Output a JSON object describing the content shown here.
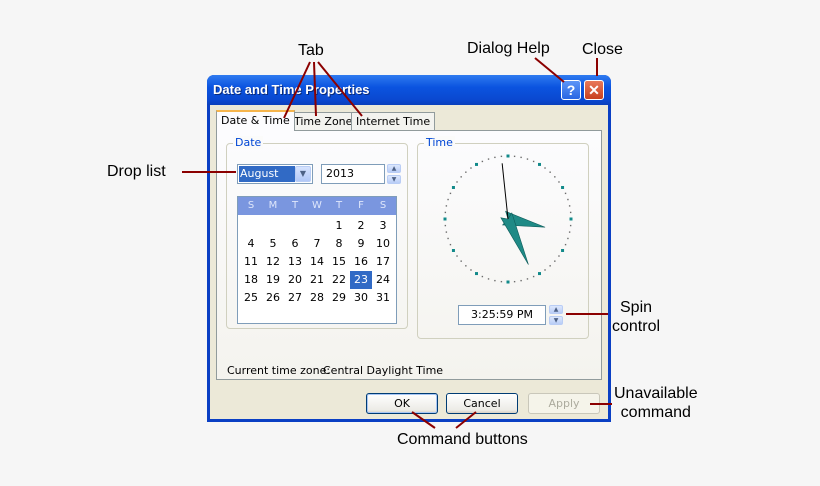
{
  "callouts": {
    "tab": "Tab",
    "dialog_help": "Dialog Help",
    "close": "Close",
    "drop_list": "Drop list",
    "spin_control": [
      "Spin",
      "control"
    ],
    "unavailable_command": [
      "Unavailable",
      "command"
    ],
    "command_buttons": "Command buttons"
  },
  "window": {
    "title": "Date and Time Properties",
    "help_label": "?",
    "close_label": "✕"
  },
  "tabs": [
    {
      "label": "Date & Time",
      "active": true
    },
    {
      "label": "Time Zone",
      "active": false
    },
    {
      "label": "Internet Time",
      "active": false
    }
  ],
  "date_group": {
    "label": "Date",
    "month": "August",
    "year": "2013",
    "weekdays": [
      "S",
      "M",
      "T",
      "W",
      "T",
      "F",
      "S"
    ],
    "weeks": [
      [
        "",
        "",
        "",
        "",
        "1",
        "2",
        "3"
      ],
      [
        "4",
        "5",
        "6",
        "7",
        "8",
        "9",
        "10"
      ],
      [
        "11",
        "12",
        "13",
        "14",
        "15",
        "16",
        "17"
      ],
      [
        "18",
        "19",
        "20",
        "21",
        "22",
        "23",
        "24"
      ],
      [
        "25",
        "26",
        "27",
        "28",
        "29",
        "30",
        "31"
      ]
    ],
    "selected_day": "23"
  },
  "time_group": {
    "label": "Time",
    "time_value": "3:25:59 PM",
    "clock": {
      "hour": 3,
      "minute": 25,
      "second": 59
    }
  },
  "timezone": {
    "label": "Current time zone:",
    "value": "Central Daylight Time"
  },
  "buttons": {
    "ok": "OK",
    "cancel": "Cancel",
    "apply": "Apply"
  },
  "colors": {
    "title_bar": "#0b54e0",
    "selection": "#316ac5",
    "group_label": "#0046d5",
    "clock_hands": "#1f8a86",
    "callout_arrow": "#8b0000"
  }
}
